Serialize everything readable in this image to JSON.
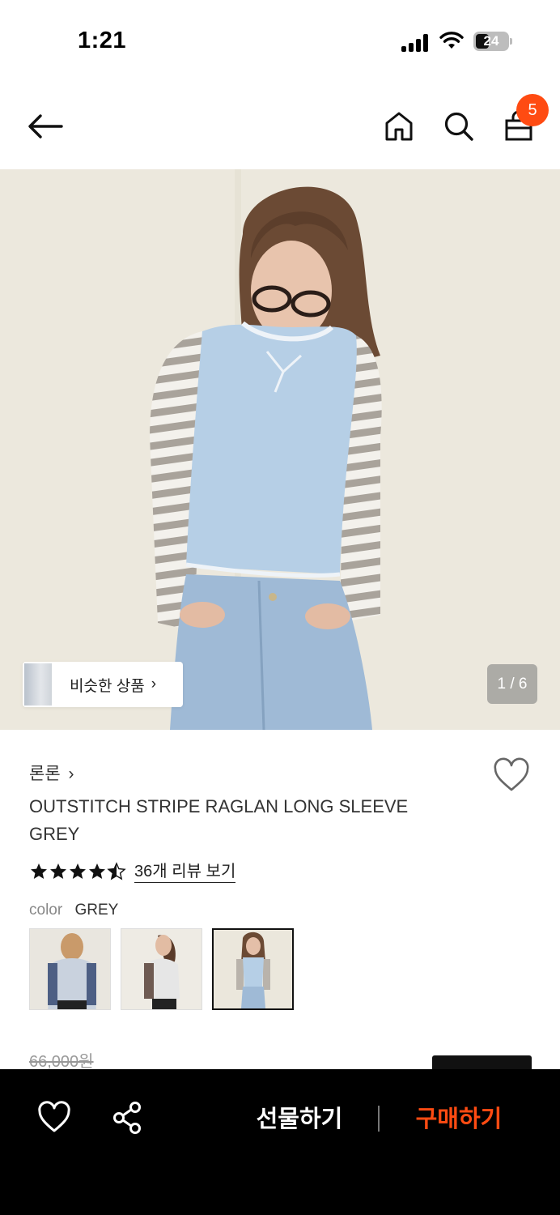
{
  "status_bar": {
    "time": "1:21",
    "battery": "24",
    "icons": [
      "signal-icon",
      "wifi-icon",
      "battery-icon"
    ]
  },
  "nav": {
    "cart_badge": "5",
    "icons": [
      "back-arrow-icon",
      "home-icon",
      "search-icon",
      "shopping-bag-icon"
    ]
  },
  "hero": {
    "similar_label": "비슷한 상품",
    "similar_chevron": "›",
    "page_indicator": "1 / 6"
  },
  "product": {
    "brand": "론론",
    "brand_chevron": "›",
    "title": "OUTSTITCH STRIPE RAGLAN LONG SLEEVE GREY",
    "rating": 4.5,
    "review_link": "36개 리뷰 보기",
    "color_key": "color",
    "color_value": "GREY",
    "original_price": "66,000원"
  },
  "bottom_bar": {
    "gift_label": "선물하기",
    "buy_label": "구매하기"
  },
  "colors": {
    "accent": "#ff4b12",
    "bottom_bar_bg": "#000000",
    "star": "#111111"
  }
}
